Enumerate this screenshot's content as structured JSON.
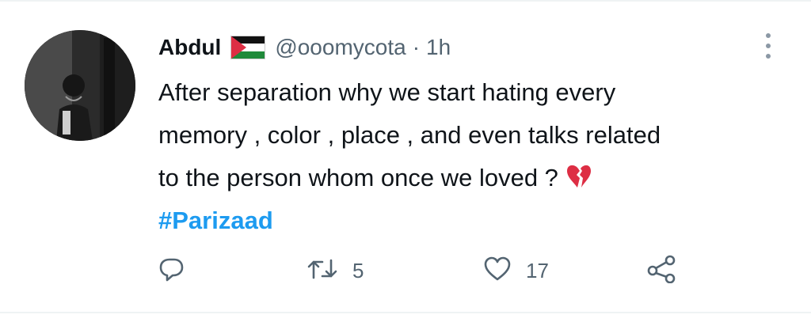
{
  "tweet": {
    "author_name": "Abdul",
    "flag_icon": "palestine-flag-icon",
    "handle": "@ooomycota",
    "separator": "·",
    "time": "1h",
    "text_lines": [
      "After separation why we start hating every",
      "memory , color , place , and even talks related",
      "to the person whom once we loved ?"
    ],
    "emoji_icon": "broken-heart-icon",
    "hashtag": "#Parizaad"
  },
  "actions": {
    "reply_icon": "reply-icon",
    "retweet_icon": "retweet-icon",
    "retweet_count": "5",
    "like_icon": "heart-icon",
    "like_count": "17",
    "share_icon": "share-icon"
  },
  "colors": {
    "accent": "#1d9bf0",
    "text": "#0f1419",
    "muted": "#536471",
    "broken_heart": "#dd2e44"
  }
}
